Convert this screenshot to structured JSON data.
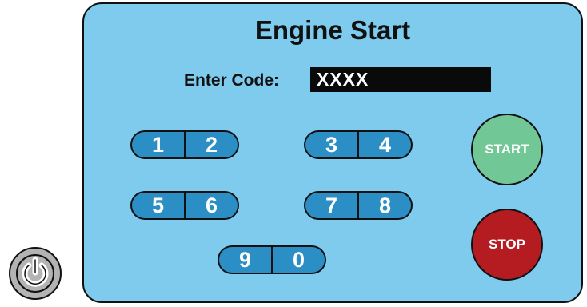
{
  "panel": {
    "title": "Engine Start",
    "code_label": "Enter Code:",
    "code_value": "XXXX"
  },
  "keypad": [
    {
      "left": "1",
      "right": "2"
    },
    {
      "left": "3",
      "right": "4"
    },
    {
      "left": "5",
      "right": "6"
    },
    {
      "left": "7",
      "right": "8"
    },
    {
      "left": "9",
      "right": "0"
    }
  ],
  "controls": {
    "start_label": "START",
    "stop_label": "STOP"
  },
  "colors": {
    "panel_bg": "#7ecbee",
    "key_bg": "#2b8fc6",
    "start_bg": "#72c796",
    "stop_bg": "#b51c22",
    "power_bg": "#b3b3b3"
  },
  "icons": {
    "power": "power-icon"
  }
}
